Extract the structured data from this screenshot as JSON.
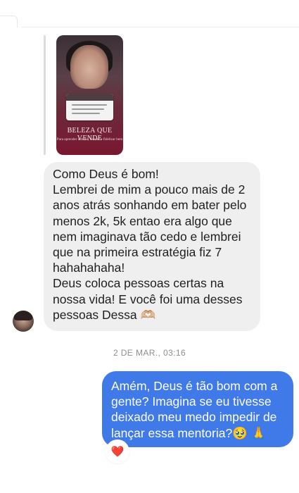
{
  "story_reply": {
    "question_title": "Qual estratégia você usou?",
    "question_lines": [
      "Por onde começo? Quero muito",
      "faturar os meus primeiros 5k"
    ],
    "headline": "BELEZA QUE VENDE",
    "subline": "Para aprender a atrair, vender e fidelizar bem"
  },
  "incoming_message": {
    "text": "Como Deus é bom!\nLembrei de mim a pouco mais de 2 anos atrás sonhando em bater pelo menos 2k, 5k entao era algo que nem imaginava tão cedo e lembrei que na primeira estratégia fiz 7 hahahahaha!\nDeus coloca pessoas certas na nossa vida! E você foi uma desses pessoas Dessa 🫶🏼"
  },
  "timestamp": "2 DE MAR., 03:16",
  "outgoing_message": {
    "text": "Amém, Deus é tão bom com a gente? Imagina se eu tivesse deixado meu medo impedir de lançar essa mentoria?🥹 🙏"
  },
  "reaction": {
    "emoji": "❤️",
    "icon": "heart-icon",
    "color": "#e0245e"
  },
  "colors": {
    "incoming_bubble": "#efefef",
    "outgoing_bubble": "#3f7ae8",
    "timestamp": "#8e8e8e"
  }
}
